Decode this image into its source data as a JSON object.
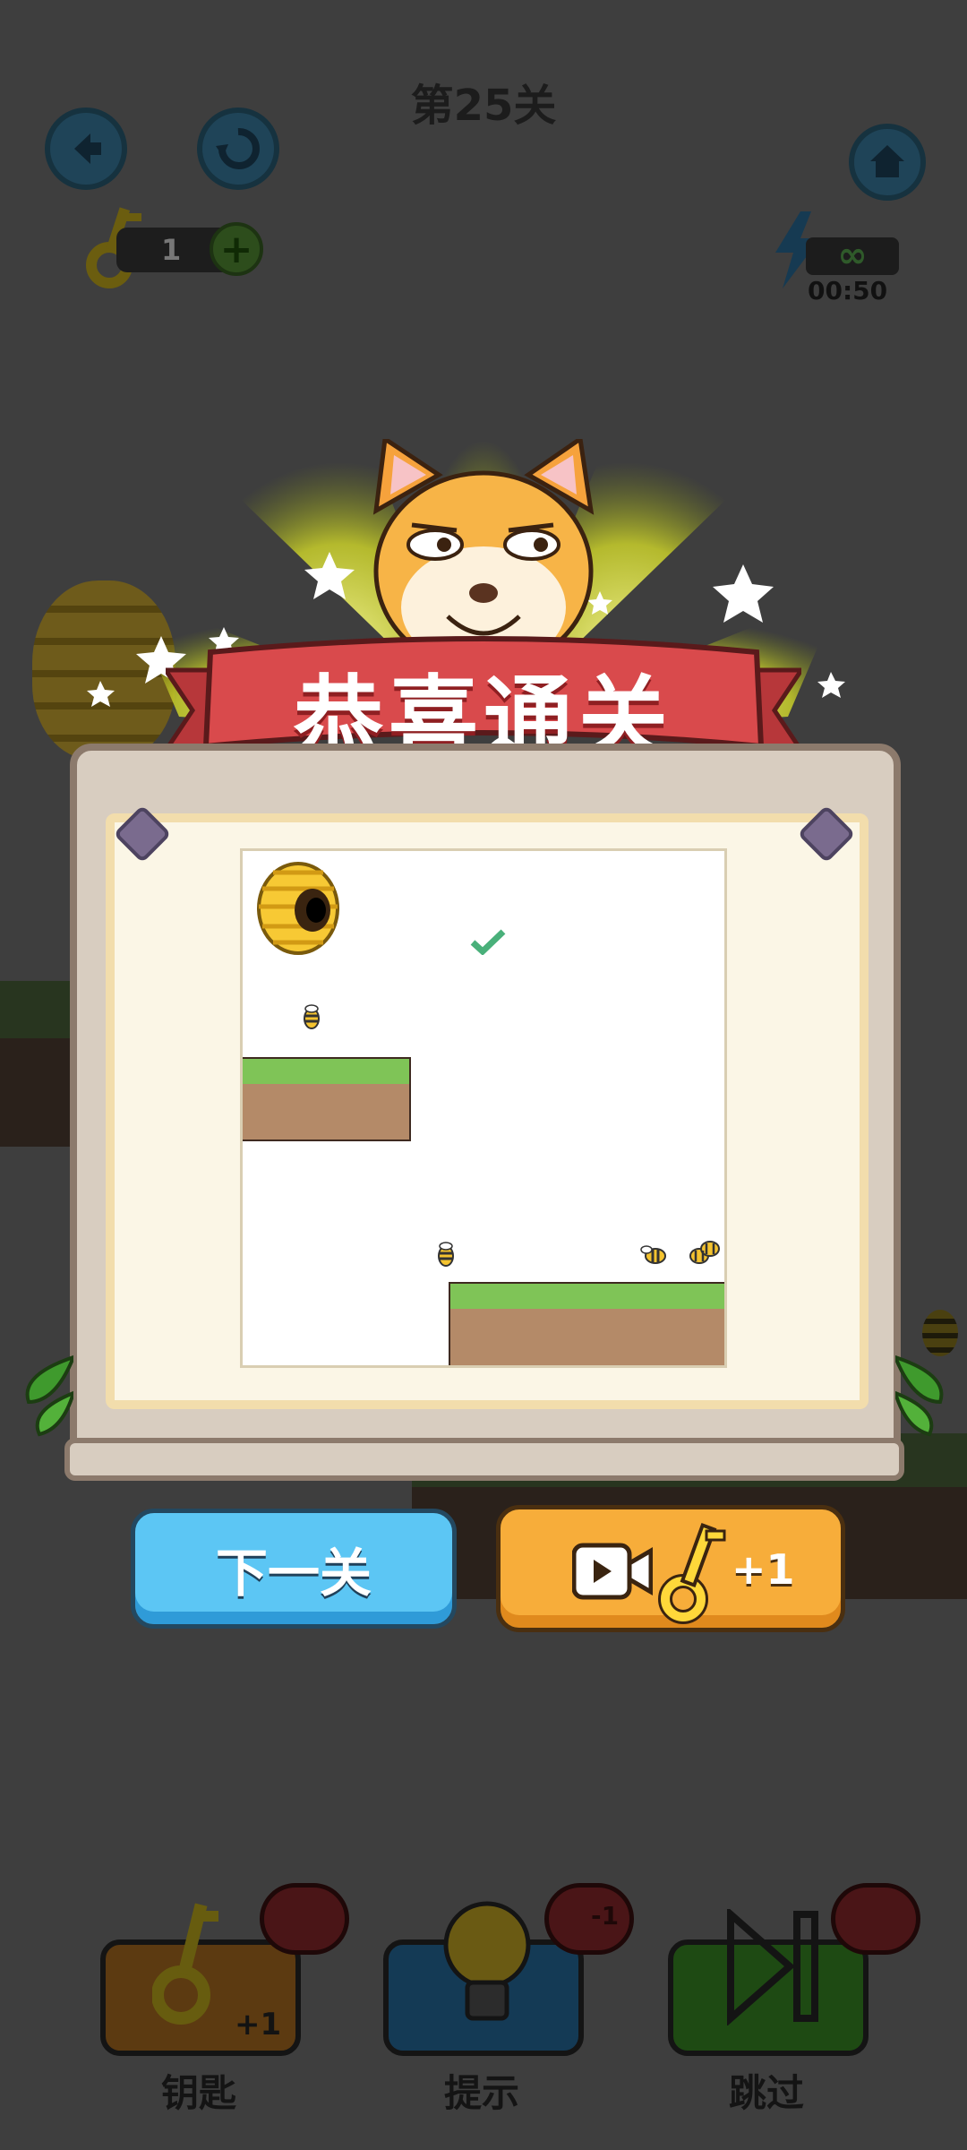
{
  "header": {
    "level_title": "第25关",
    "keys_count": "1",
    "keys_add_label": "+",
    "energy_value": "∞",
    "timer": "00:50"
  },
  "popup": {
    "banner_text": "恭喜通关",
    "next_button_label": "下一关",
    "video_reward_label": "+1"
  },
  "toolbar": {
    "items": [
      {
        "label": "钥匙",
        "sub": "+1",
        "icon": "key-icon"
      },
      {
        "label": "提示",
        "sub": "-1",
        "icon": "lightbulb-icon"
      },
      {
        "label": "跳过",
        "sub": "",
        "icon": "skip-icon"
      }
    ]
  },
  "colors": {
    "background": "#3e3e3e",
    "banner_red": "#d94a4c",
    "next_blue": "#5cc6f4",
    "video_orange": "#f7ad3a",
    "grass": "#7fc457",
    "dirt": "#b48a68"
  }
}
